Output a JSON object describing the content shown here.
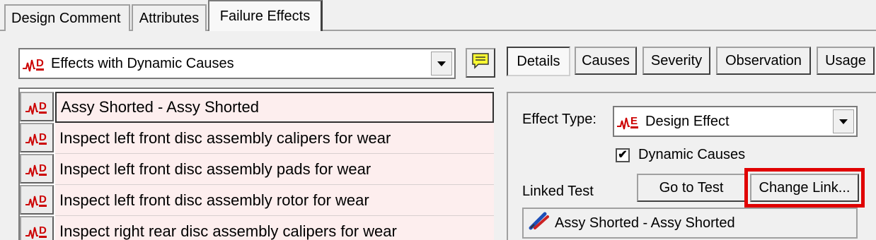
{
  "top_tabs": [
    {
      "label": "Design Comment"
    },
    {
      "label": "Attributes"
    },
    {
      "label": "Failure Effects"
    }
  ],
  "effects_filter": {
    "selected": "Effects with Dynamic Causes",
    "icon": "dynamic-effect-icon"
  },
  "note_button": {
    "icon": "note-icon"
  },
  "detail_tabs": [
    {
      "label": "Details"
    },
    {
      "label": "Causes"
    },
    {
      "label": "Severity"
    },
    {
      "label": "Observation"
    },
    {
      "label": "Usage"
    }
  ],
  "effects_list": [
    {
      "text": "Assy Shorted - Assy Shorted",
      "icon": "dynamic-effect-icon"
    },
    {
      "text": "Inspect left front disc assembly calipers for wear",
      "icon": "dynamic-effect-icon"
    },
    {
      "text": "Inspect left front disc assembly pads for wear",
      "icon": "dynamic-effect-icon"
    },
    {
      "text": "Inspect left front disc assembly rotor for wear",
      "icon": "dynamic-effect-icon"
    },
    {
      "text": "Inspect right rear disc assembly calipers for wear",
      "icon": "dynamic-effect-icon"
    }
  ],
  "details": {
    "effect_type_label": "Effect Type:",
    "effect_type_value": "Design Effect",
    "dynamic_causes_label": "Dynamic Causes",
    "dynamic_causes_checked": true,
    "linked_test_label": "Linked Test",
    "go_to_test_label": "Go to Test",
    "change_link_label": "Change Link...",
    "linked_test_value": "Assy Shorted - Assy Shorted"
  },
  "colors": {
    "row_background": "#fdeeee",
    "highlight": "#e00000",
    "icon_red": "#cc0000",
    "note_yellow": "#ffff33"
  }
}
